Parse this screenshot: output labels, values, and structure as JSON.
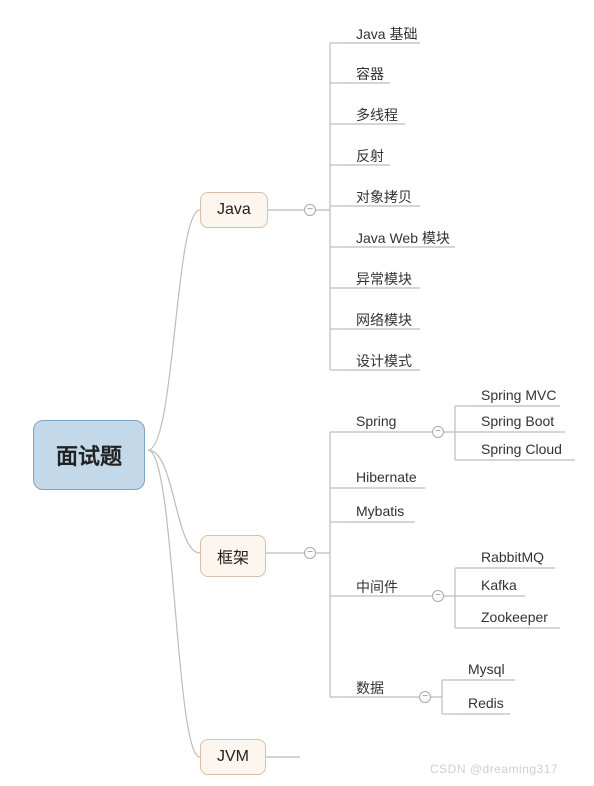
{
  "root": {
    "label": "面试题"
  },
  "level2": {
    "java": {
      "label": "Java"
    },
    "framework": {
      "label": "框架"
    },
    "jvm": {
      "label": "JVM"
    }
  },
  "java_children": {
    "c0": "Java 基础",
    "c1": "容器",
    "c2": "多线程",
    "c3": "反射",
    "c4": "对象拷贝",
    "c5": "Java Web 模块",
    "c6": "异常模块",
    "c7": "网络模块",
    "c8": "设计模式"
  },
  "framework_children": {
    "spring": {
      "label": "Spring",
      "sub": {
        "s0": "Spring MVC",
        "s1": "Spring Boot",
        "s2": "Spring Cloud"
      }
    },
    "hibernate": {
      "label": "Hibernate"
    },
    "mybatis": {
      "label": "Mybatis"
    },
    "middleware": {
      "label": "中间件",
      "sub": {
        "m0": "RabbitMQ",
        "m1": "Kafka",
        "m2": "Zookeeper"
      }
    },
    "data": {
      "label": "数据",
      "sub": {
        "d0": "Mysql",
        "d1": "Redis"
      }
    }
  },
  "toggle": {
    "symbol": "−"
  },
  "watermark": {
    "text": "CSDN @dreaming317"
  }
}
